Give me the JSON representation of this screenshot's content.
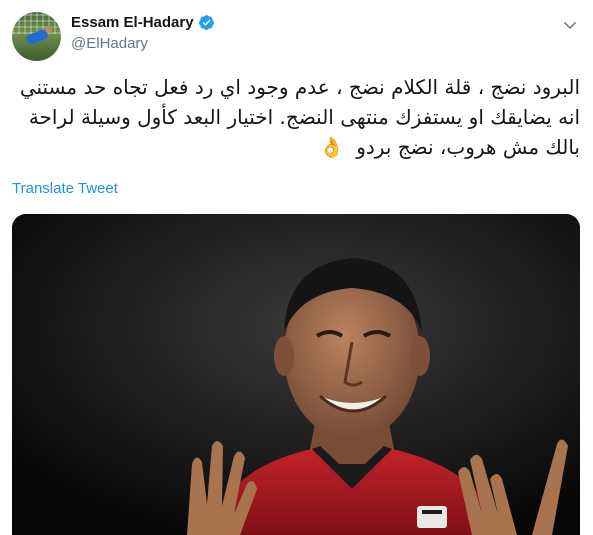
{
  "user": {
    "display_name": "Essam El-Hadary",
    "handle": "@ElHadary",
    "verified": true,
    "avatar_icon": "goalkeeper-avatar"
  },
  "menu_icon": "chevron-down-icon",
  "tweet": {
    "text": "البرود نضج ، قلة الكلام نضج ، عدم وجود اي رد فعل تجاه حد مستني انه يضايقك او يستفزك منتهى النضج. اختيار البعد كأول وسيلة لراحة بالك مش هروب، نضج بردو",
    "emoji": "👌"
  },
  "translate_label": "Translate Tweet",
  "media": {
    "type": "photo",
    "icon": "tweet-photo"
  },
  "colors": {
    "link": "#1b95e0",
    "handle": "#657786",
    "verified": "#1da1f2",
    "text": "#14171a"
  }
}
